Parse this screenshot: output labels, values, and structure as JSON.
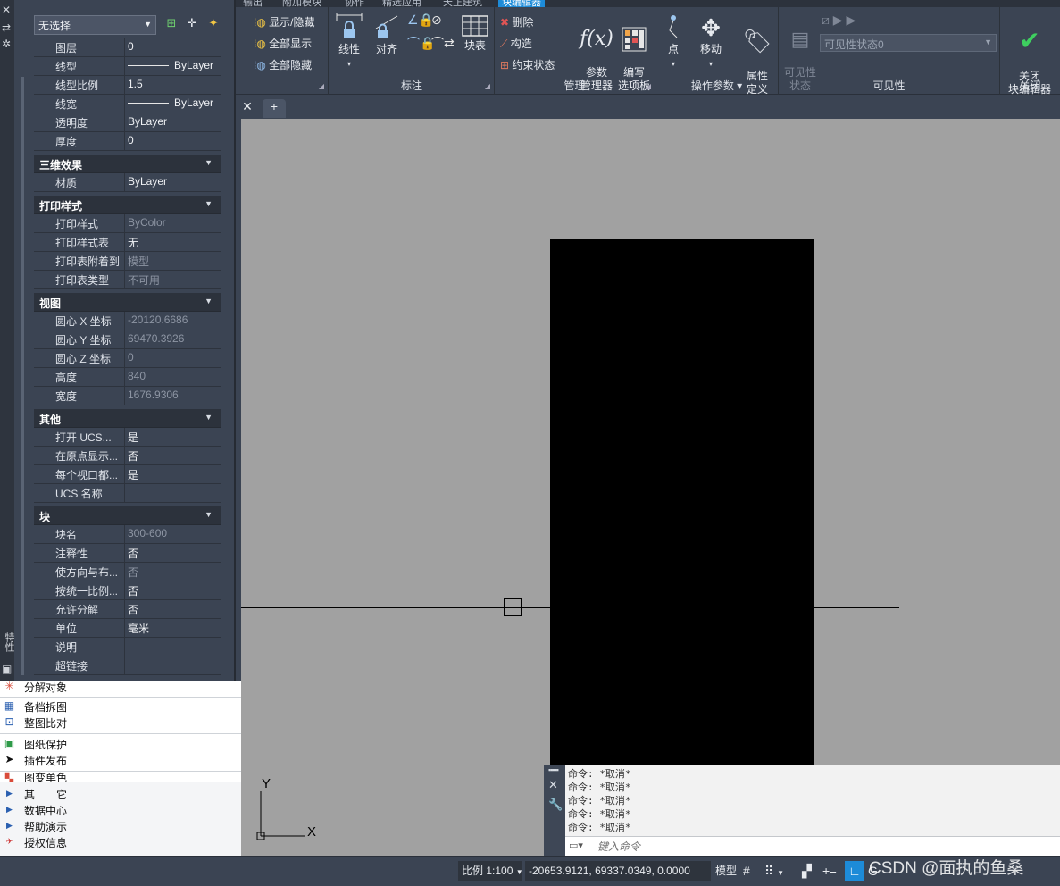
{
  "ribbon": {
    "tabs": [
      "输出",
      "附加模块",
      "协作",
      "精选应用",
      "天正建筑",
      "块编辑器"
    ],
    "active_tab": "块编辑器",
    "visibility_group": {
      "items": [
        "显示/隐藏",
        "全部显示",
        "全部隐藏"
      ]
    },
    "dimension_group": {
      "title": "标注",
      "linear_label": "线性",
      "aligned_label": "对齐"
    },
    "block_table_label": "块表",
    "manage_group": {
      "title": "管理",
      "delete_label": "删除",
      "construct_label": "构造",
      "constraint_state_label": "约束状态",
      "param_manager_label": "参数\n管理器",
      "authoring_palette_label": "编写\n选项板"
    },
    "action_param_group": {
      "title": "操作参数",
      "point_label": "点",
      "move_label": "移动",
      "attribute_label": "属性\n定义"
    },
    "visibility_state_group": {
      "title": "可见性",
      "state_button_label": "可见性\n状态",
      "state_dropdown_value": "可见性状态0"
    },
    "close_group": {
      "title": "关闭",
      "close_editor_label": "关闭\n块编辑器"
    }
  },
  "palette": {
    "selection_dropdown": "无选择",
    "sections": {
      "general_rows": [
        {
          "k": "图层",
          "v": "0"
        },
        {
          "k": "线型",
          "v": "ByLayer",
          "line": true
        },
        {
          "k": "线型比例",
          "v": "1.5"
        },
        {
          "k": "线宽",
          "v": "ByLayer",
          "line": true
        },
        {
          "k": "透明度",
          "v": "ByLayer"
        },
        {
          "k": "厚度",
          "v": "0"
        }
      ],
      "3d_title": "三维效果",
      "3d_rows": [
        {
          "k": "材质",
          "v": "ByLayer"
        }
      ],
      "plot_title": "打印样式",
      "plot_rows": [
        {
          "k": "打印样式",
          "v": "ByColor",
          "gray": true
        },
        {
          "k": "打印样式表",
          "v": "无"
        },
        {
          "k": "打印表附着到",
          "v": "模型",
          "gray": true
        },
        {
          "k": "打印表类型",
          "v": "不可用",
          "gray": true
        }
      ],
      "view_title": "视图",
      "view_rows": [
        {
          "k": "圆心 X 坐标",
          "v": "-20120.6686",
          "gray": true
        },
        {
          "k": "圆心 Y 坐标",
          "v": "69470.3926",
          "gray": true
        },
        {
          "k": "圆心 Z 坐标",
          "v": "0",
          "gray": true
        },
        {
          "k": "高度",
          "v": "840",
          "gray": true
        },
        {
          "k": "宽度",
          "v": "1676.9306",
          "gray": true
        }
      ],
      "misc_title": "其他",
      "misc_rows": [
        {
          "k": "打开 UCS...",
          "v": "是"
        },
        {
          "k": "在原点显示...",
          "v": "否"
        },
        {
          "k": "每个视口都...",
          "v": "是"
        },
        {
          "k": "UCS 名称",
          "v": ""
        }
      ],
      "block_title": "块",
      "block_rows": [
        {
          "k": "块名",
          "v": "300-600",
          "gray": true
        },
        {
          "k": "注释性",
          "v": "否"
        },
        {
          "k": "使方向与布...",
          "v": "否",
          "gray": true
        },
        {
          "k": "按统一比例...",
          "v": "否"
        },
        {
          "k": "允许分解",
          "v": "否"
        },
        {
          "k": "单位",
          "v": "毫米"
        },
        {
          "k": "说明",
          "v": ""
        },
        {
          "k": "超链接",
          "v": ""
        }
      ]
    },
    "side_label": "特性"
  },
  "toollist": {
    "items": [
      "分解对象",
      "备档拆图",
      "整图比对",
      "图纸保护",
      "插件发布",
      "图变单色"
    ],
    "nav_items": [
      "其　　它",
      "数据中心",
      "帮助演示",
      "授权信息"
    ]
  },
  "command": {
    "history": [
      "命令: *取消*",
      "命令: *取消*",
      "命令: *取消*",
      "命令: *取消*",
      "命令: *取消*"
    ],
    "placeholder": "键入命令"
  },
  "ucs_labels": {
    "x": "X",
    "y": "Y"
  },
  "status": {
    "scale": "比例 1:100",
    "coords": "-20653.9121, 69337.0349, 0.0000",
    "model_label": "模型"
  },
  "watermark": "CSDN @面执的鱼桑"
}
